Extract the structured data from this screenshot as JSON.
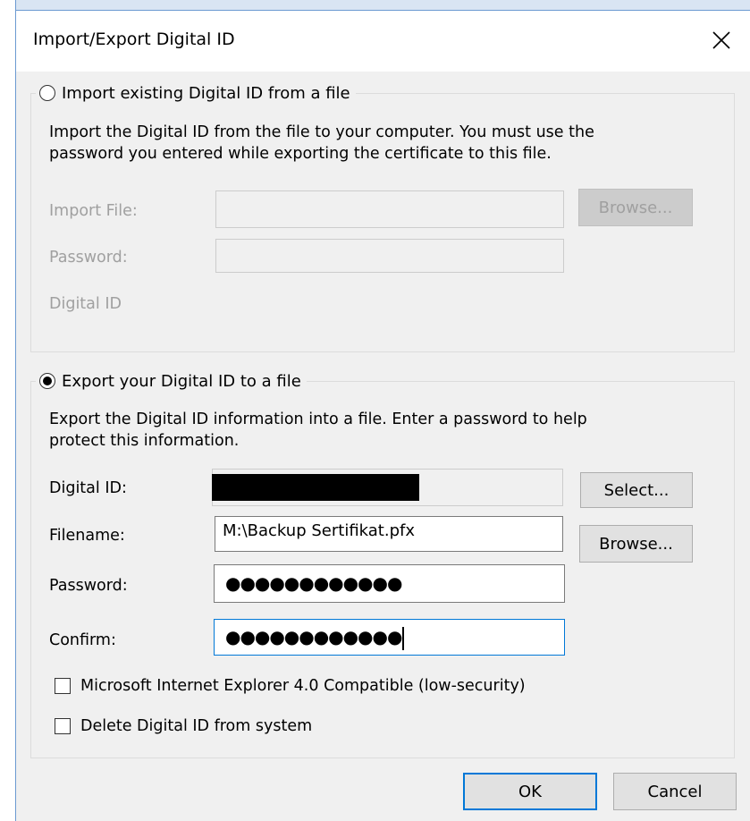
{
  "dialog": {
    "title": "Import/Export Digital ID"
  },
  "import_section": {
    "label": "Import existing Digital ID from a file",
    "selected": false,
    "description_line1": "Import the Digital ID from the file to your computer. You must use the",
    "description_line2": "password you entered while exporting the certificate to this file.",
    "import_file_label": "Import File:",
    "import_file_value": "",
    "browse_label": "Browse...",
    "password_label": "Password:",
    "password_value": "",
    "digital_id_label": "Digital ID"
  },
  "export_section": {
    "label": "Export your Digital ID to a file",
    "selected": true,
    "description_line1": "Export the Digital ID information into a file. Enter a password to help",
    "description_line2": "protect this information.",
    "digital_id_label": "Digital ID:",
    "select_label": "Select...",
    "filename_label": "Filename:",
    "filename_value": "M:\\Backup Sertifikat.pfx",
    "browse_label": "Browse...",
    "password_label": "Password:",
    "password_value": "●●●●●●●●●●●●",
    "confirm_label": "Confirm:",
    "confirm_value": "●●●●●●●●●●●●",
    "ie4_compatible_label": "Microsoft Internet Explorer 4.0 Compatible (low-security)",
    "ie4_compatible_checked": false,
    "delete_id_label": "Delete Digital ID from system",
    "delete_id_checked": false
  },
  "footer": {
    "ok_label": "OK",
    "cancel_label": "Cancel"
  },
  "colors": {
    "accent": "#0078d7",
    "dialog_bg": "#f0f0f0",
    "disabled_text": "#a0a0a0",
    "redaction": "#000000"
  }
}
